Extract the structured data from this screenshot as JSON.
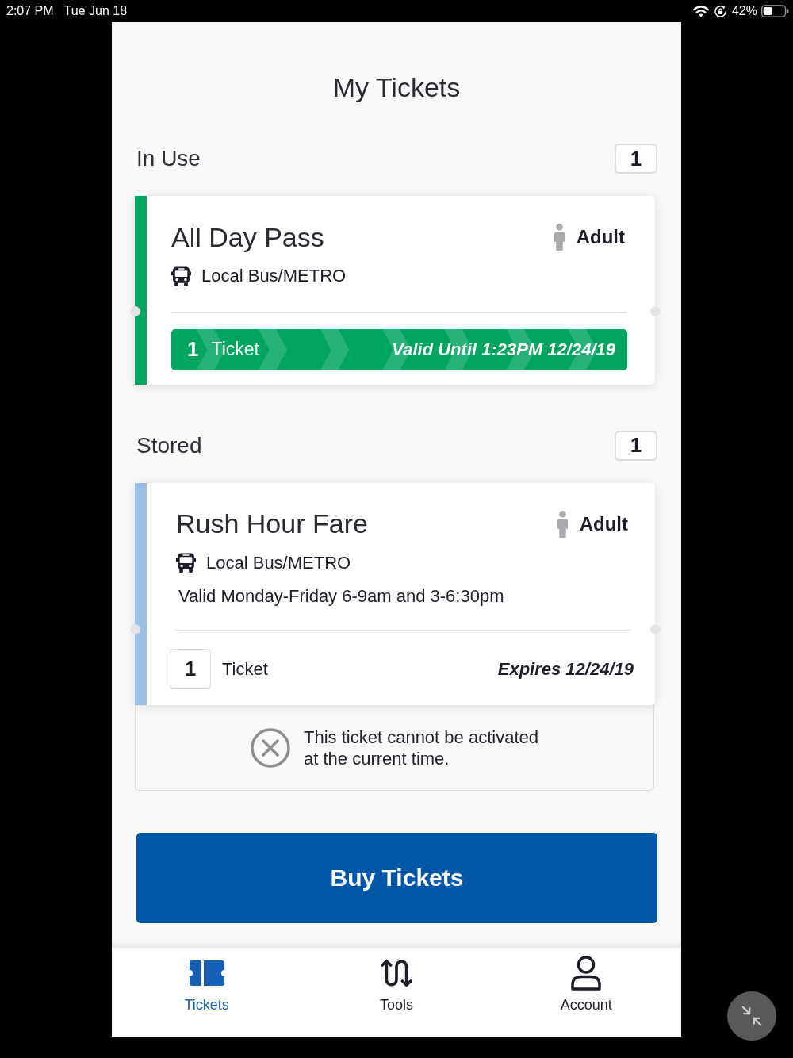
{
  "status_bar": {
    "time": "2:07 PM",
    "date": "Tue Jun 18",
    "battery": "42%"
  },
  "header": {
    "title": "My Tickets"
  },
  "sections": [
    {
      "title": "In Use",
      "count": "1",
      "tickets": [
        {
          "kind": "active",
          "name": "All Day Pass",
          "rider": "Adult",
          "service": "Local Bus/METRO",
          "quantity": "1",
          "unit": "Ticket",
          "validity": "Valid Until 1:23PM 12/24/19"
        }
      ]
    },
    {
      "title": "Stored",
      "count": "1",
      "tickets": [
        {
          "kind": "stored",
          "name": "Rush Hour Fare",
          "rider": "Adult",
          "service": "Local Bus/METRO",
          "schedule": "Valid Monday-Friday 6-9am and 3-6:30pm",
          "quantity": "1",
          "unit": "Ticket",
          "validity": "Expires 12/24/19",
          "notice": "This ticket cannot be activated\nat the current time."
        }
      ]
    }
  ],
  "buy_button": {
    "label": "Buy Tickets"
  },
  "tab_bar": {
    "tabs": [
      {
        "label": "Tickets",
        "selected": true
      },
      {
        "label": "Tools",
        "selected": false
      },
      {
        "label": "Account",
        "selected": false
      }
    ]
  }
}
